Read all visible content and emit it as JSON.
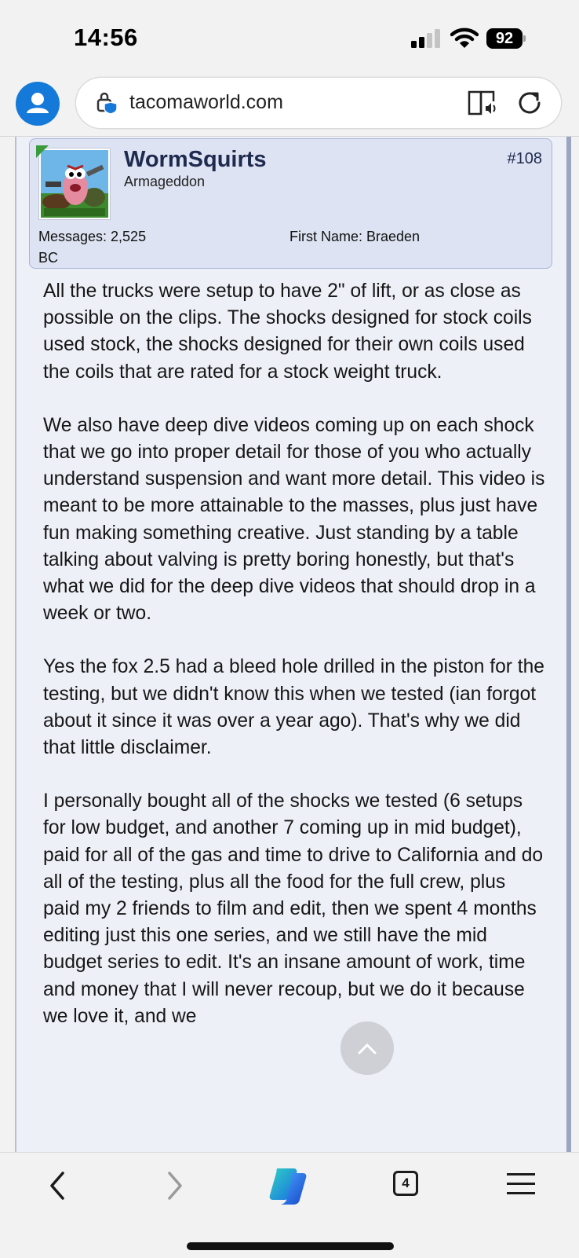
{
  "status_bar": {
    "time": "14:56",
    "battery": "92"
  },
  "browser": {
    "url": "tacomaworld.com",
    "tab_count": "4",
    "icons": [
      "profile-icon",
      "lock-shield-icon",
      "reader-mode-icon",
      "reload-icon",
      "back-icon",
      "forward-icon",
      "copilot-icon",
      "tabs-icon",
      "menu-icon"
    ],
    "accent": "#1479d8"
  },
  "post": {
    "user": {
      "name": "WormSquirts",
      "title": "Armageddon",
      "messages": "Messages: 2,525",
      "first_name": "First Name: Braeden",
      "location": "BC"
    },
    "number": "#108",
    "paragraphs": [
      "All the trucks were setup to have 2\" of lift, or as close as possible on the clips. The shocks designed for stock coils used stock, the shocks designed for their own coils used the coils that are rated for a stock weight truck.",
      "We also have deep dive videos coming up on each shock that we go into proper detail for those of you who actually understand suspension and want more detail. This video is meant to be more attainable to the masses, plus just have fun making something creative. Just standing by a table talking about valving is pretty boring honestly, but that's what we did for the deep dive videos that should drop in a week or two.",
      "Yes the fox 2.5 had a bleed hole drilled in the piston for the testing, but we didn't know this when we tested (ian forgot about it since it was over a year ago). That's why we did that little disclaimer.",
      "I personally bought all of the shocks we tested (6 setups for low budget, and another 7 coming up in mid budget), paid for all of the gas and time to drive to California and do all of the testing, plus all the food for the full crew, plus paid my 2 friends to film and edit, then we spent 4 months editing just this one series, and we still have the mid budget series to edit. It's an insane amount of work, time and money that I will never recoup, but we do it because we love it, and we"
    ]
  }
}
